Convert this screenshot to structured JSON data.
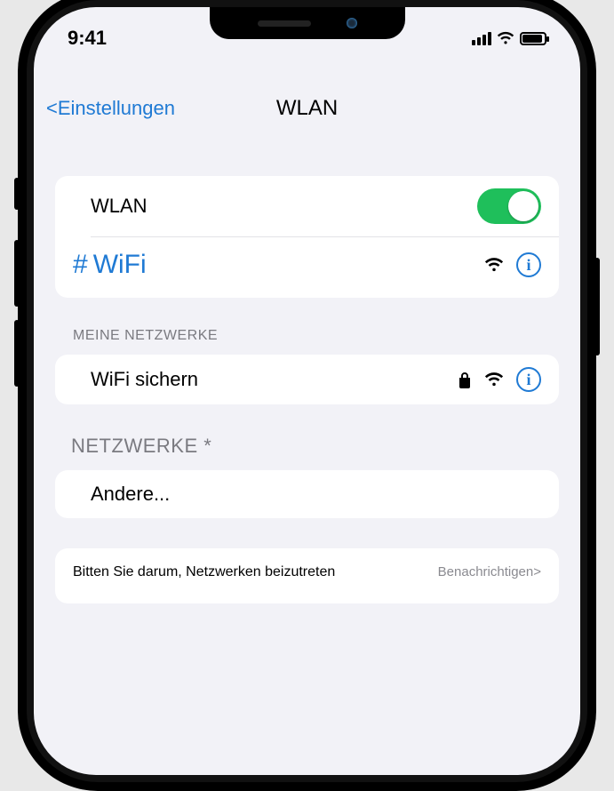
{
  "status": {
    "time": "9:41"
  },
  "nav": {
    "back": "<Einstellungen",
    "title": "WLAN"
  },
  "wlan": {
    "label": "WLAN",
    "toggle_on": true,
    "connected_prefix": "#",
    "connected_name": "WiFi"
  },
  "sections": {
    "my_networks_label": "MEINE NETZWERKE",
    "my_networks": [
      {
        "name": "WiFi sichern",
        "locked": true
      }
    ],
    "other_networks_label": "NETZWERKE *",
    "other_label": "Andere..."
  },
  "ask": {
    "text": "Bitten Sie darum, Netzwerken beizutreten",
    "value": "Benachrichtigen>"
  }
}
